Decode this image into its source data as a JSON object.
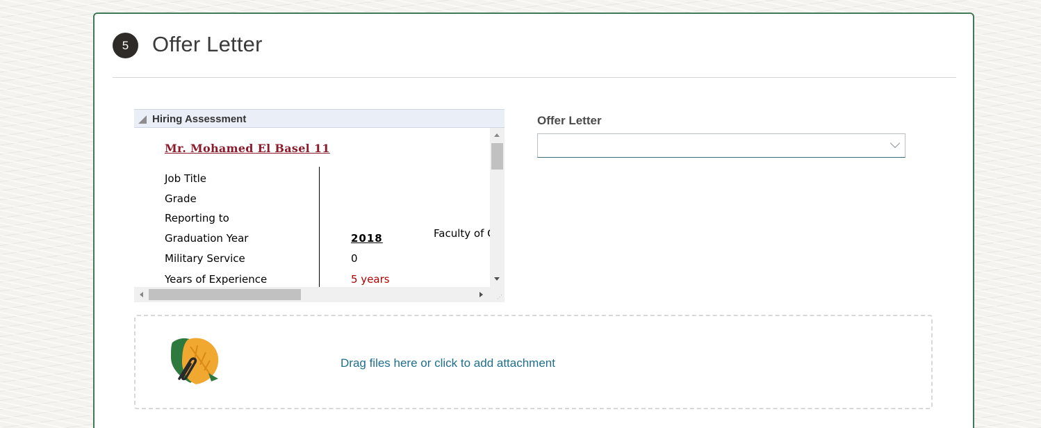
{
  "step": {
    "number": "5",
    "title": "Offer Letter"
  },
  "hiring_assessment": {
    "header": "Hiring Assessment",
    "candidate_name": "Mr. Mohamed El Basel 11",
    "rows": [
      {
        "label": "Job Title",
        "value": "",
        "extra": ""
      },
      {
        "label": "Grade",
        "value": "",
        "extra": ""
      },
      {
        "label": "Reporting to",
        "value": "",
        "extra": ""
      },
      {
        "label": "Graduation Year",
        "value": "2018",
        "extra": "Faculty of C"
      },
      {
        "label": "Military Service",
        "value": "0",
        "extra": ""
      },
      {
        "label": "Years of Experience",
        "value": "5 years",
        "extra": ""
      }
    ],
    "colors": {
      "name": "#8b1a2b",
      "experience": "#b00000"
    }
  },
  "offer_letter_field": {
    "label": "Offer Letter",
    "value": ""
  },
  "attachment": {
    "text": "Drag files here or click to add attachment",
    "icon": "leaf-paperclip-icon"
  },
  "theme": {
    "card_border": "#3d7a56",
    "link": "#1f6e8c"
  }
}
